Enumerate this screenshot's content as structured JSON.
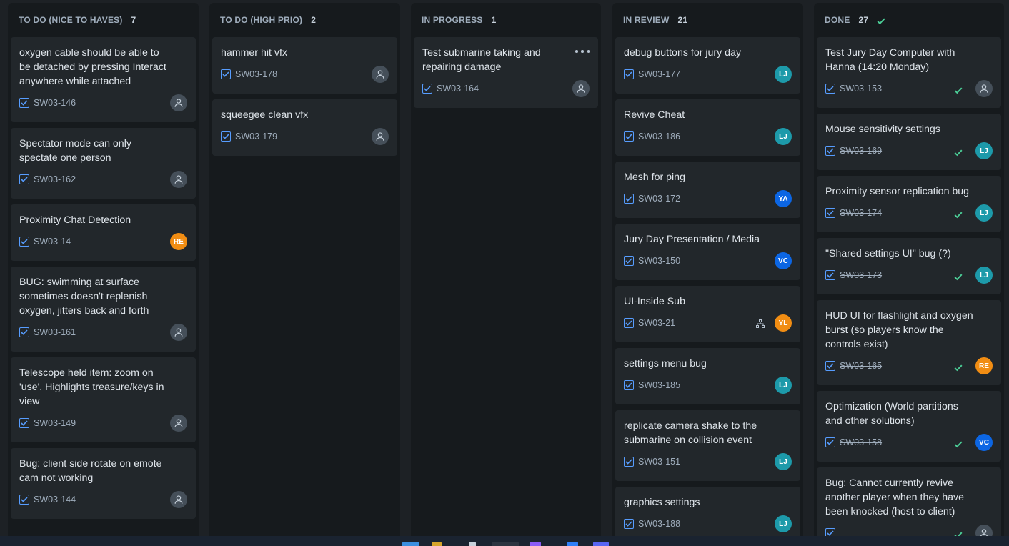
{
  "colors": {
    "RE": "#f18d13",
    "LJ": "#1d9aaa",
    "YA": "#0c66e4",
    "VC": "#0c66e4",
    "YL": "#f18d13",
    "check_blue": "#579dff",
    "check_green": "#4bce97"
  },
  "columns": [
    {
      "title": "TO DO (NICE TO HAVES)",
      "count": "7",
      "done": false,
      "cards": [
        {
          "title": "oxygen cable should be able to be detached by pressing Interact anywhere while attached",
          "key": "SW03-146",
          "avatar": ""
        },
        {
          "title": "Spectator mode can only spectate one person",
          "key": "SW03-162",
          "avatar": ""
        },
        {
          "title": "Proximity Chat Detection",
          "key": "SW03-14",
          "avatar": "RE"
        },
        {
          "title": "BUG: swimming at surface sometimes doesn't replenish oxygen, jitters back and forth",
          "key": "SW03-161",
          "avatar": ""
        },
        {
          "title": "Telescope held item: zoom on 'use'. Highlights treasure/keys in view",
          "key": "SW03-149",
          "avatar": ""
        },
        {
          "title": "Bug: client side rotate on emote cam not working",
          "key": "SW03-144",
          "avatar": ""
        }
      ]
    },
    {
      "title": "TO DO (HIGH PRIO)",
      "count": "2",
      "done": false,
      "cards": [
        {
          "title": "hammer hit vfx",
          "key": "SW03-178",
          "avatar": ""
        },
        {
          "title": "squeegee clean vfx",
          "key": "SW03-179",
          "avatar": ""
        }
      ]
    },
    {
      "title": "IN PROGRESS",
      "count": "1",
      "done": false,
      "cards": [
        {
          "title": "Test submarine taking and repairing damage",
          "key": "SW03-164",
          "avatar": "",
          "more": true
        }
      ]
    },
    {
      "title": "IN REVIEW",
      "count": "21",
      "done": false,
      "cards": [
        {
          "title": "debug buttons for jury day",
          "key": "SW03-177",
          "avatar": "LJ"
        },
        {
          "title": "Revive Cheat",
          "key": "SW03-186",
          "avatar": "LJ"
        },
        {
          "title": "Mesh for ping",
          "key": "SW03-172",
          "avatar": "YA"
        },
        {
          "title": "Jury Day Presentation / Media",
          "key": "SW03-150",
          "avatar": "VC"
        },
        {
          "title": "UI-Inside Sub",
          "key": "SW03-21",
          "avatar": "YL",
          "hierarchy": true
        },
        {
          "title": "settings menu bug",
          "key": "SW03-185",
          "avatar": "LJ"
        },
        {
          "title": "replicate camera shake to the submarine on collision event",
          "key": "SW03-151",
          "avatar": "LJ"
        },
        {
          "title": "graphics settings",
          "key": "SW03-188",
          "avatar": "LJ"
        }
      ]
    },
    {
      "title": "DONE",
      "count": "27",
      "done": true,
      "cards": [
        {
          "title": "Test Jury Day Computer with Hanna (14:20 Monday)",
          "key": "SW03-153",
          "avatar": ""
        },
        {
          "title": "Mouse sensitivity settings",
          "key": "SW03-169",
          "avatar": "LJ"
        },
        {
          "title": "Proximity sensor replication bug",
          "key": "SW03-174",
          "avatar": "LJ"
        },
        {
          "title": "\"Shared settings UI\" bug (?)",
          "key": "SW03-173",
          "avatar": "LJ"
        },
        {
          "title": "HUD UI for flashlight and oxygen burst (so players know the controls exist)",
          "key": "SW03-165",
          "avatar": "RE"
        },
        {
          "title": "Optimization (World partitions and other solutions)",
          "key": "SW03-158",
          "avatar": "VC"
        },
        {
          "title": "Bug: Cannot currently revive another player when they have been knocked (host to client)",
          "key": "",
          "avatar": ""
        }
      ]
    }
  ]
}
